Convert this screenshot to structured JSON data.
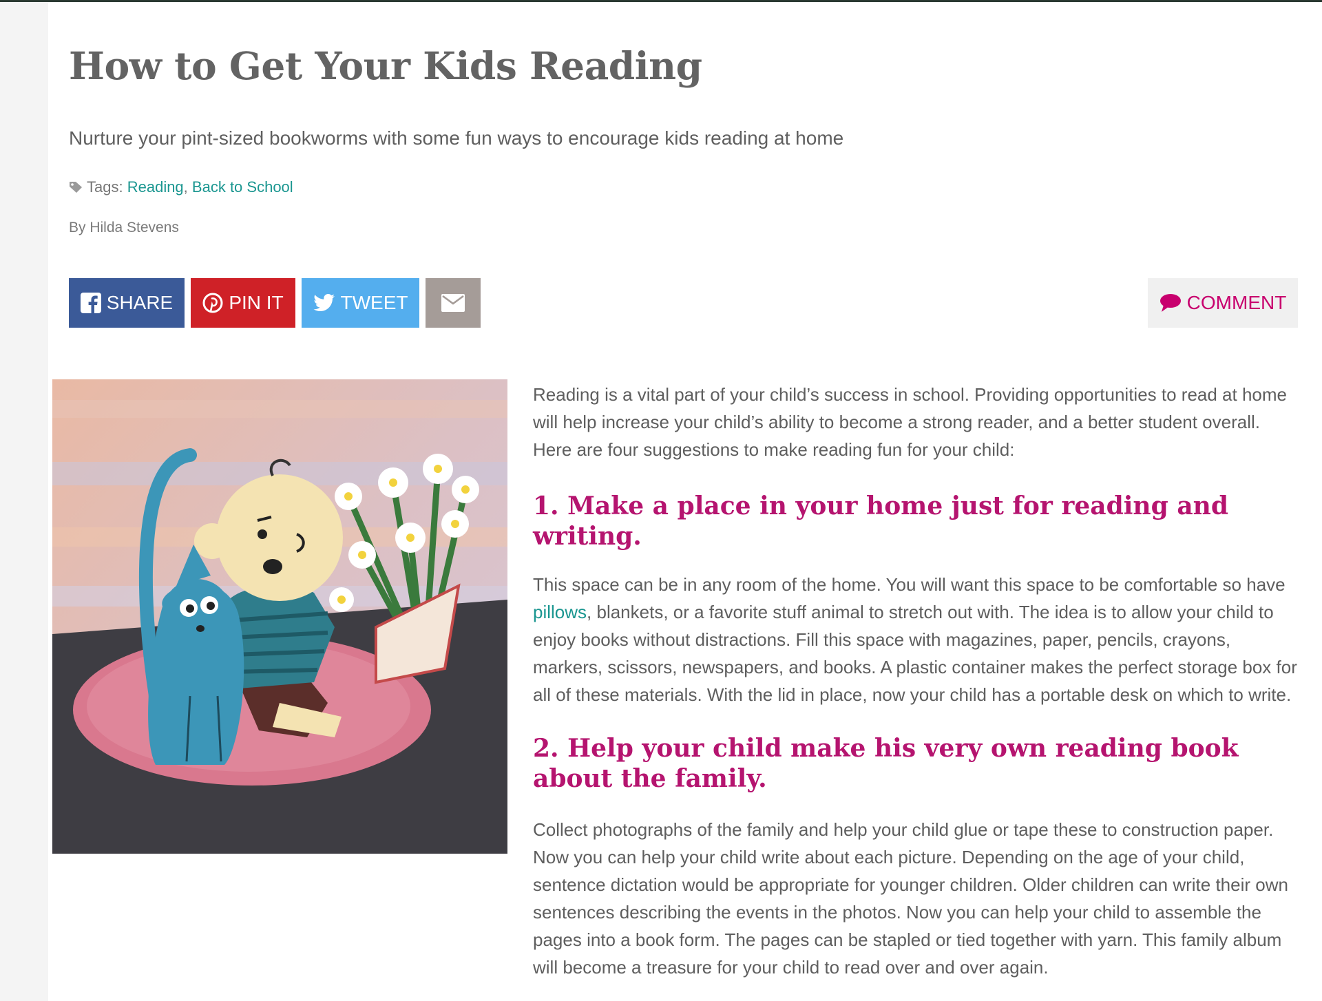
{
  "article": {
    "title": "How to Get Your Kids Reading",
    "subtitle": "Nurture your pint-sized bookworms with some fun ways to encourage kids reading at home",
    "tags_label": "Tags:",
    "tags": [
      "Reading",
      "Back to School"
    ],
    "tag_separator": ",",
    "byline": "By Hilda Stevens",
    "intro": "Reading is a vital part of your child’s success in school. Providing opportunities to read at home will help increase your child’s ability to become a strong reader, and a better student overall. Here are four suggestions to make reading fun for your child:",
    "sections": [
      {
        "heading": "1. Make a place in your home just for reading and writing.",
        "body_before_link": "This space can be in any room of the home. You will want this space to be comfortable so have ",
        "link_text": "pillows",
        "body_after_link": ", blankets, or a favorite stuff animal to stretch out with. The idea is to allow your child to enjoy books without distractions. Fill this space with magazines, paper, pencils, crayons, markers, scissors, newspapers, and books. A plastic container makes the perfect storage box for all of these materials.  With the lid in place, now your child has a portable desk on which to write."
      },
      {
        "heading": "2. Help your child make his very own reading book about the family.",
        "body": "Collect photographs of the family and help your child glue or tape these to construction paper. Now you can help your child write about each picture. Depending on the age of your child, sentence dictation would be appropriate for younger children. Older children can write their own sentences describing the events in the photos. Now you can help your child to assemble the pages into a book form. The pages can be stapled or tied together with yarn. This family album will become a treasure for your child to read over and over again."
      }
    ]
  },
  "share": {
    "facebook_label": "SHARE",
    "pinterest_label": "PIN IT",
    "twitter_label": "TWEET",
    "email_icon": "envelope-icon",
    "comment_label": "COMMENT"
  },
  "icons": {
    "tag": "tag-icon",
    "facebook": "facebook-icon",
    "pinterest": "pinterest-icon",
    "twitter": "twitter-bird-icon",
    "comment": "speech-bubble-icon"
  },
  "colors": {
    "title": "#636363",
    "heading": "#b5146f",
    "link": "#1a9690",
    "facebook": "#3b5a98",
    "pinterest": "#cf2127",
    "twitter": "#54aeee",
    "email": "#a59c98",
    "comment_text": "#c8006e"
  }
}
